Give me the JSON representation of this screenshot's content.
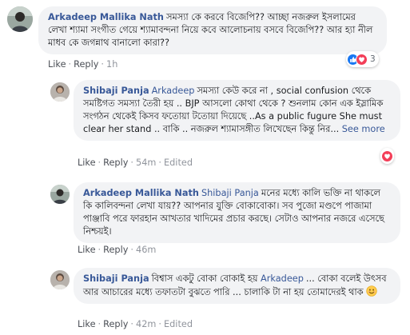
{
  "comments": [
    {
      "author": "Arkadeep Mallika Nath",
      "text": "সমস্যা কে করবে বিজেপি?? আচ্ছা নজরুল ইসলামের লেখা শ্যামা সংগীত গেয়ে শ্যামাবন্দনা নিয়ে কবে আলোচনায় বসবে বিজেপি?? আর হ্যা নীল মাধব কে জগন্নাথ বানালো কারা??",
      "actions": {
        "like": "Like",
        "reply": "Reply",
        "time": "1h"
      },
      "reactions": {
        "icons": [
          "like-icon",
          "love-icon"
        ],
        "count": "3"
      },
      "replies": [
        {
          "author": "Shibaji Panja",
          "tag": "Arkadeep",
          "text": "সমস্যা কেউ করে না , social confusion থেকে সমষ্টিগত সমস্যা তৈরী হয় .. BJP আসলো কোথা থেকে ? শুনলাম কোন এক ইস্লামিক সংগঠন থেকেই কিসব ফতোয়া টতোয়া দিয়েছে ..As a public fugure She must clear her stand .. বাকি .. নজরুল শ্যামাসঙ্গীত লিখেছেন কিন্তু নির...",
          "see_more": "See more",
          "actions": {
            "like": "Like",
            "reply": "Reply",
            "time": "54m",
            "edited": "Edited"
          },
          "reactions": {
            "icons": [
              "love-icon"
            ]
          }
        },
        {
          "author": "Arkadeep Mallika Nath",
          "tag": "Shibaji Panja",
          "text": "মনের মধ্যে কালি ভক্তি না থাকলে কি কালিবন্দনা লেখা যায়?? আপনার যুক্তি বোকাবোকা। সব পুজো মণ্ডপে পাজামা পাঞ্জাবি পরে ফারহান আখতার খাদিমের প্রচার করছে। সেটাও আপনার নজরে এসেছে নিশ্চয়ই।",
          "actions": {
            "like": "Like",
            "reply": "Reply",
            "time": "46m"
          }
        },
        {
          "author": "Shibaji Panja",
          "text_before": "বিশ্বাস একটু বোকা বোকাই হয়",
          "tag": "Arkadeep",
          "text": "... বোকা বলেই উৎসব আর আচারের মধ্যে তফাতটা বুঝতে পারি ... চালাকি টা না হয় তোমাদেরই থাক",
          "emoji": "smiling-face-emoji",
          "actions": {
            "like": "Like",
            "reply": "Reply",
            "time": "42m",
            "edited": "Edited"
          }
        }
      ]
    }
  ],
  "colors": {
    "name": "#385898",
    "bubble": "#f2f3f5",
    "meta": "#90949c",
    "like": "#1877f2",
    "love": "#f33e58"
  }
}
